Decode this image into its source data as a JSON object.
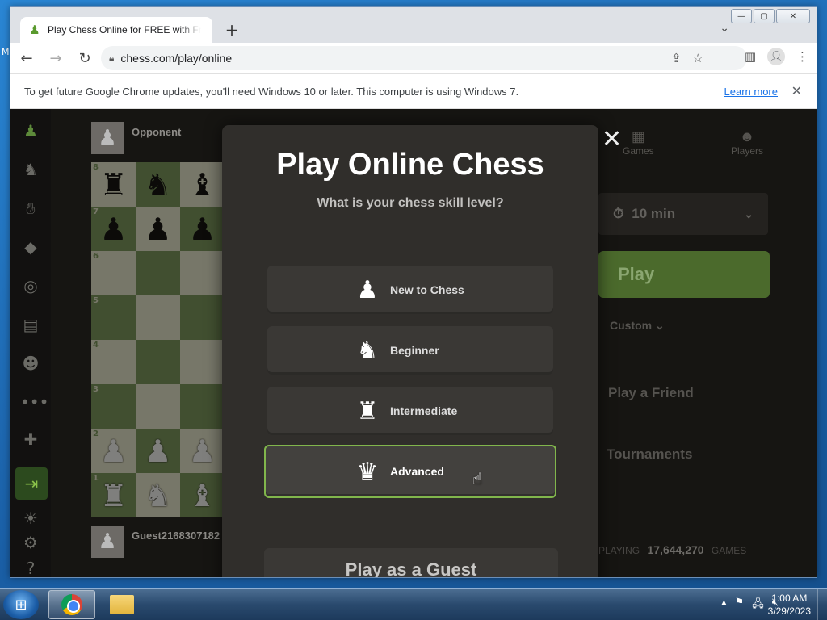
{
  "desktop": {
    "edge_text": "M"
  },
  "browser": {
    "tab_title": "Play Chess Online for FREE with Friends",
    "url": "chess.com/play/online",
    "window_controls": {
      "minimize": "—",
      "maximize": "▢",
      "close": "✕"
    },
    "infobar": {
      "message": "To get future Google Chrome updates, you'll need Windows 10 or later. This computer is using Windows 7.",
      "link": "Learn more"
    }
  },
  "page": {
    "opponent_name": "Opponent",
    "guest_name": "Guest2168307182",
    "right_panel": {
      "tab_games": "Games",
      "tab_players": "Players",
      "time_control": "10 min",
      "play_button": "Play",
      "custom": "Custom",
      "play_friend": "Play a Friend",
      "tournaments": "Tournaments",
      "playing_label": "PLAYING",
      "games_count": "17,644,270",
      "games_label": "GAMES"
    },
    "modal": {
      "title": "Play Online Chess",
      "subtitle": "What is your chess skill level?",
      "options": [
        {
          "label": "New to Chess",
          "icon": "pawn-icon",
          "glyph": "♟"
        },
        {
          "label": "Beginner",
          "icon": "knight-icon",
          "glyph": "♞"
        },
        {
          "label": "Intermediate",
          "icon": "rook-icon",
          "glyph": "♜"
        },
        {
          "label": "Advanced",
          "icon": "queen-icon",
          "glyph": "♛",
          "selected": true
        }
      ],
      "guest_button": "Play as a Guest"
    }
  },
  "taskbar": {
    "time": "1:00 AM",
    "date": "3/29/2023"
  }
}
